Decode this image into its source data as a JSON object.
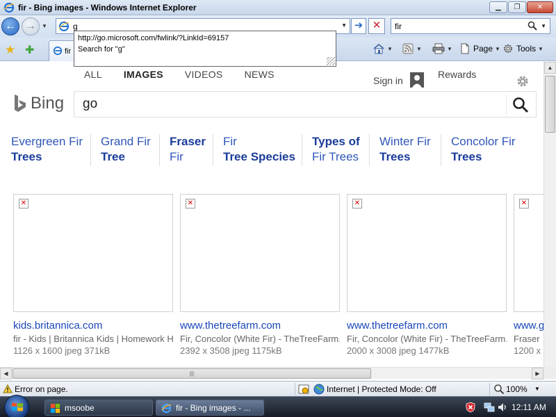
{
  "window": {
    "title": "fir - Bing images - Windows Internet Explorer"
  },
  "address_bar": {
    "value": "g",
    "suggestions": [
      "http://go.microsoft.com/fwlink/?LinkId=69157",
      "Search for \"g\""
    ]
  },
  "search_box": {
    "value": "fir"
  },
  "tab": {
    "label": "fir"
  },
  "command_bar": {
    "page_label": "Page",
    "tools_label": "Tools"
  },
  "bing": {
    "nav": [
      "ALL",
      "IMAGES",
      "VIDEOS",
      "NEWS"
    ],
    "active_nav": "IMAGES",
    "sign_in": "Sign in",
    "rewards": "Rewards",
    "logo_text": "Bing",
    "query": "go",
    "related": [
      {
        "line1": "Evergreen Fir",
        "line2": "Trees"
      },
      {
        "line1": "Grand Fir",
        "line2": "Tree"
      },
      {
        "line1": "Fraser",
        "line2": "Fir"
      },
      {
        "line1": "Fir",
        "line2": "Tree Species"
      },
      {
        "line1": "Types of",
        "line2": "Fir Trees"
      },
      {
        "line1": "Winter Fir",
        "line2": "Trees"
      },
      {
        "line1": "Concolor Fir",
        "line2": "Trees"
      }
    ],
    "results": [
      {
        "domain": "kids.britannica.com",
        "desc": "fir - Kids | Britannica Kids | Homework Help",
        "meta": "1126 x 1600 jpeg 371kB"
      },
      {
        "domain": "www.thetreefarm.com",
        "desc": "Fir, Concolor (White Fir) - TheTreeFarm.com",
        "meta": "2392 x 3508 jpeg 1175kB"
      },
      {
        "domain": "www.thetreefarm.com",
        "desc": "Fir, Concolor (White Fir) - TheTreeFarm.com",
        "meta": "2000 x 3008 jpeg 1477kB"
      },
      {
        "domain": "www.g",
        "desc": "Fraser",
        "meta": "1200 x"
      }
    ]
  },
  "status_bar": {
    "message": "Error on page.",
    "zone": "Internet | Protected Mode: Off",
    "zoom": "100%"
  },
  "taskbar": {
    "tasks": [
      "msoobe",
      "fir - Bing images - ..."
    ],
    "clock": "12:11 AM"
  }
}
